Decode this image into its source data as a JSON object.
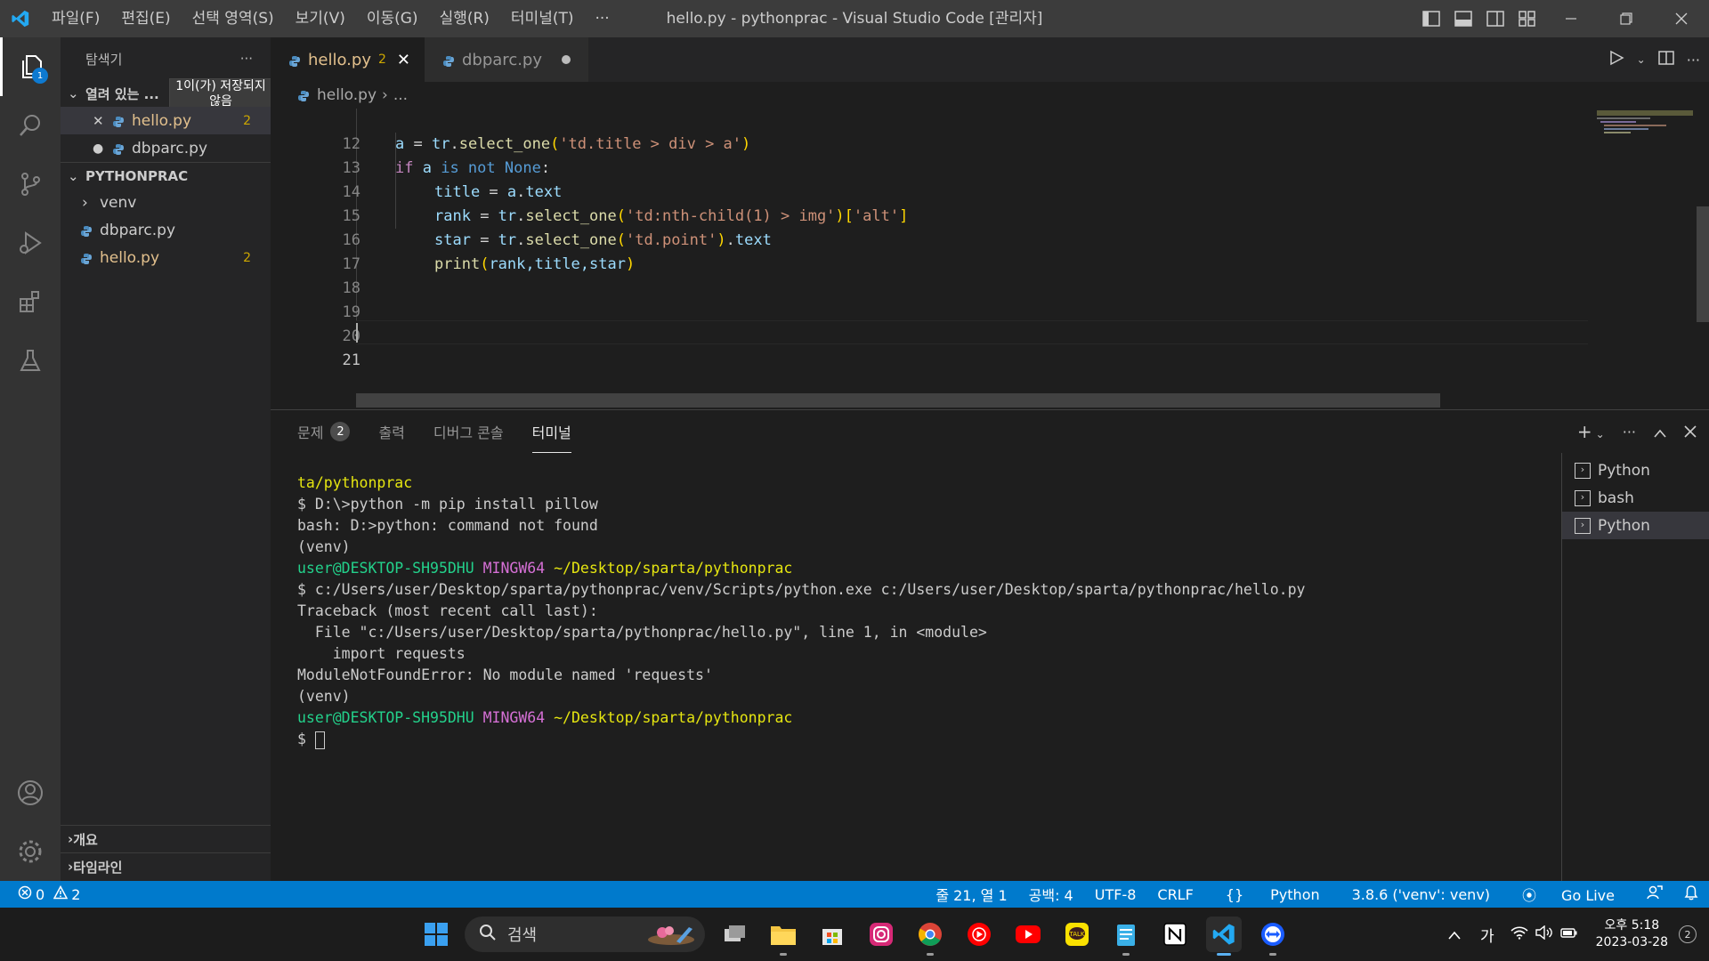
{
  "window": {
    "title": "hello.py - pythonprac - Visual Studio Code [관리자]",
    "menu": [
      "파일(F)",
      "편집(E)",
      "선택 영역(S)",
      "보기(V)",
      "이동(G)",
      "실행(R)",
      "터미널(T)",
      "···"
    ]
  },
  "activity": {
    "explorer_badge": "1"
  },
  "sidebar": {
    "title": "탐색기",
    "more": "···",
    "open_editors_label": "열려 있는 ...",
    "tooltip": "1이(가) 저장되지 않음",
    "open_editors": [
      {
        "name": "hello.py",
        "count": "2",
        "marker": "✕"
      },
      {
        "name": "dbparc.py",
        "count": "",
        "marker": "●"
      }
    ],
    "project_label": "PYTHONPRAC",
    "tree": [
      {
        "name": "venv",
        "type": "folder"
      },
      {
        "name": "dbparc.py",
        "type": "file",
        "count": ""
      },
      {
        "name": "hello.py",
        "type": "file",
        "count": "2"
      }
    ],
    "outline_label": "개요",
    "timeline_label": "타임라인"
  },
  "tabs": [
    {
      "name": "hello.py",
      "count": "2",
      "state": "active"
    },
    {
      "name": "dbparc.py",
      "count": "",
      "state": "modified"
    }
  ],
  "breadcrumb": {
    "file": "hello.py",
    "rest": "..."
  },
  "editor": {
    "current_line": 21,
    "lines": [
      {
        "n": "12"
      },
      {
        "n": "13"
      },
      {
        "n": "14"
      },
      {
        "n": "15"
      },
      {
        "n": "16"
      },
      {
        "n": "17"
      },
      {
        "n": "18"
      },
      {
        "n": "19"
      },
      {
        "n": "20"
      },
      {
        "n": "21"
      }
    ],
    "code": {
      "l12": {
        "a": "a",
        "eq": " = ",
        "tr": "tr",
        "dot": ".",
        "fn": "select_one",
        "p1": "(",
        "s": "'td.title > div > a'",
        "p2": ")"
      },
      "l13": {
        "if": "if",
        "a": " a ",
        "is": "is",
        "not": " not ",
        "none": "None",
        "colon": ":"
      },
      "l14": {
        "title": "title",
        "eq": " = ",
        "a": "a",
        "dot": ".",
        "text": "text"
      },
      "l15": {
        "rank": "rank",
        "eq": " = ",
        "tr": "tr",
        "dot": ".",
        "fn": "select_one",
        "p1": "(",
        "s": "'td:nth-child(1) > img'",
        "p2": ")",
        "b1": "[",
        "alt": "'alt'",
        "b2": "]"
      },
      "l16": {
        "star": "star",
        "eq": " = ",
        "tr": "tr",
        "dot": ".",
        "fn": "select_one",
        "p1": "(",
        "s": "'td.point'",
        "p2": ")",
        "dot2": ".",
        "text": "text"
      },
      "l17": {
        "fn": "print",
        "p1": "(",
        "args": "rank,title,star",
        "p2": ")"
      }
    }
  },
  "panel": {
    "tabs": [
      {
        "label": "문제",
        "badge": "2"
      },
      {
        "label": "출력"
      },
      {
        "label": "디버그 콘솔"
      },
      {
        "label": "터미널"
      }
    ],
    "terminal_lines": {
      "l1": "ta/pythonprac",
      "l2": "$ D:\\>python -m pip install pillow",
      "l3": "bash: D:>python: command not found",
      "l4": "(venv)",
      "l5_user": "user@DESKTOP-SH95DHU",
      "l5_env": "MINGW64",
      "l5_path": "~/Desktop/sparta/pythonprac",
      "l6": "$ c:/Users/user/Desktop/sparta/pythonprac/venv/Scripts/python.exe c:/Users/user/Desktop/sparta/pythonprac/hello.py",
      "l7": "Traceback (most recent call last):",
      "l8": "  File \"c:/Users/user/Desktop/sparta/pythonprac/hello.py\", line 1, in <module>",
      "l9": "    import requests",
      "l10": "ModuleNotFoundError: No module named 'requests'",
      "l11": "(venv)",
      "l12_user": "user@DESKTOP-SH95DHU",
      "l12_env": "MINGW64",
      "l12_path": "~/Desktop/sparta/pythonprac",
      "l13": "$ "
    },
    "terminals": [
      {
        "name": "Python",
        "selected": false
      },
      {
        "name": "bash",
        "selected": false
      },
      {
        "name": "Python",
        "selected": true
      }
    ]
  },
  "statusbar": {
    "errors": "0",
    "warnings": "2",
    "position": "줄 21, 열 1",
    "spaces": "공백: 4",
    "encoding": "UTF-8",
    "eol": "CRLF",
    "language": "Python",
    "interpreter": "3.8.6 ('venv': venv)",
    "golive": "Go Live"
  },
  "taskbar": {
    "search": "검색",
    "ime": "가",
    "time": "오후 5:18",
    "date": "2023-03-28",
    "notif": "2"
  },
  "colors": {
    "accent": "#007acc",
    "keyword": "#c586c0",
    "variable": "#9cdcfe",
    "function": "#dcdcaa",
    "string": "#ce9178",
    "constant": "#569cd6",
    "warning": "#cca700"
  }
}
